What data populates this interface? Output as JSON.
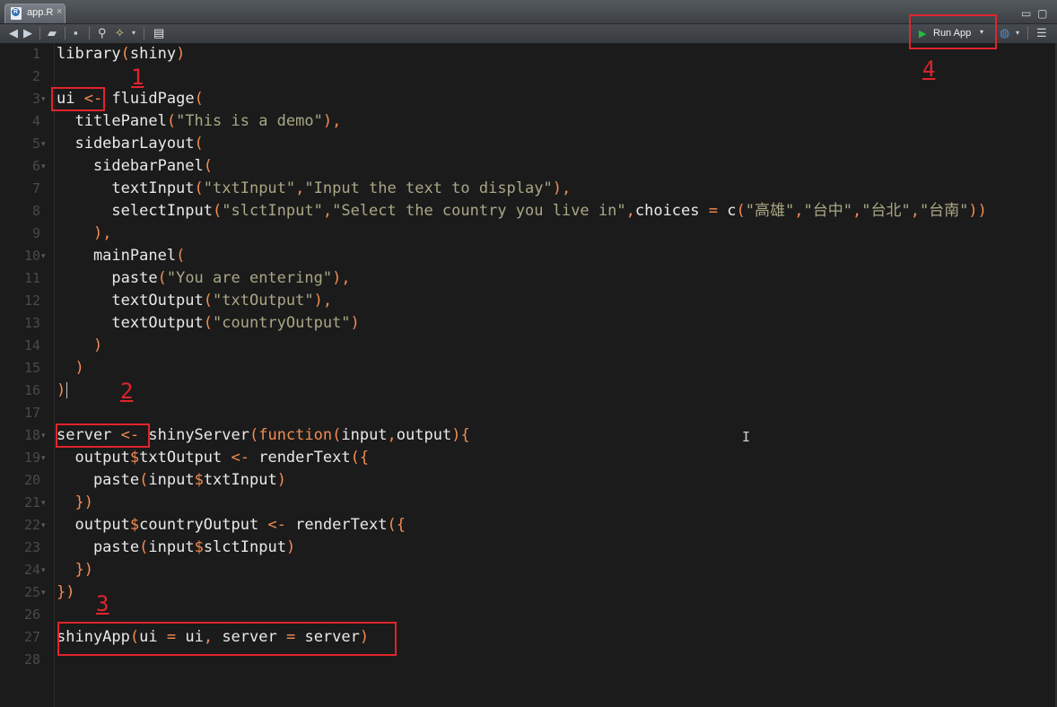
{
  "tab": {
    "filename": "app.R",
    "close": "×"
  },
  "window": {
    "minimize": "▭",
    "maximize": "▢"
  },
  "toolbar": {
    "run_app_label": "Run App",
    "run_dropdown": "▾"
  },
  "annotations": [
    "1",
    "2",
    "3",
    "4"
  ],
  "code_lines": [
    "library(shiny)",
    "",
    "ui <- fluidPage(",
    "  titlePanel(\"This is a demo\"),",
    "  sidebarLayout(",
    "    sidebarPanel(",
    "      textInput(\"txtInput\",\"Input the text to display\"),",
    "      selectInput(\"slctInput\",\"Select the country you live in\",choices = c(\"高雄\",\"台中\",\"台北\",\"台南\"))",
    "    ),",
    "    mainPanel(",
    "      paste(\"You are entering\"),",
    "      textOutput(\"txtOutput\"),",
    "      textOutput(\"countryOutput\")",
    "    )",
    "  )",
    ")",
    "",
    "server <- shinyServer(function(input,output){",
    "  output$txtOutput <- renderText({",
    "    paste(input$txtInput)",
    "  })",
    "  output$countryOutput <- renderText({",
    "    paste(input$slctInput)",
    "  })",
    "})",
    "",
    "shinyApp(ui = ui, server = server)",
    ""
  ]
}
